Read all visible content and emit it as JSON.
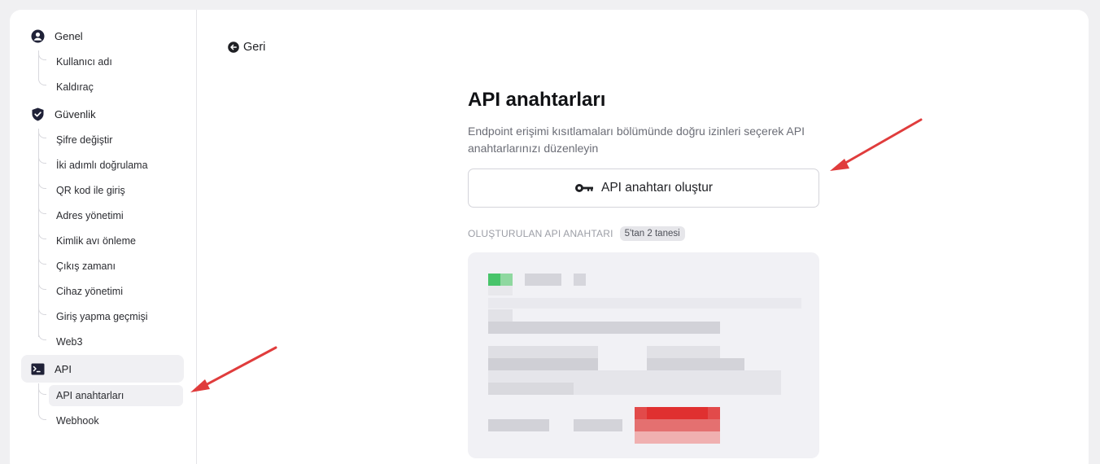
{
  "sidebar": {
    "general": {
      "label": "Genel",
      "icon": "user-circle-icon",
      "items": [
        {
          "label": "Kullanıcı adı"
        },
        {
          "label": "Kaldıraç"
        }
      ]
    },
    "security": {
      "label": "Güvenlik",
      "icon": "shield-check-icon",
      "items": [
        {
          "label": "Şifre değiştir"
        },
        {
          "label": "İki adımlı doğrulama"
        },
        {
          "label": "QR kod ile giriş"
        },
        {
          "label": "Adres yönetimi"
        },
        {
          "label": "Kimlik avı önleme"
        },
        {
          "label": "Çıkış zamanı"
        },
        {
          "label": "Cihaz yönetimi"
        },
        {
          "label": "Giriş yapma geçmişi"
        },
        {
          "label": "Web3"
        }
      ]
    },
    "api": {
      "label": "API",
      "icon": "terminal-icon",
      "items": [
        {
          "label": "API anahtarları",
          "active": true
        },
        {
          "label": "Webhook"
        }
      ]
    }
  },
  "main": {
    "back_label": "Geri",
    "title": "API anahtarları",
    "description": "Endpoint erişimi kısıtlamaları bölümünde doğru izinleri seçerek API anahtarlarınızı düzenleyin",
    "create_button_label": "API anahtarı oluştur",
    "created_keys_label": "OLUŞTURULAN API ANAHTARI",
    "created_keys_count": "5'tan 2 tanesi"
  },
  "colors": {
    "accent_active_bg": "#f0f0f3",
    "annotation_arrow": "#e03c3c",
    "text_primary": "#1f2024"
  }
}
